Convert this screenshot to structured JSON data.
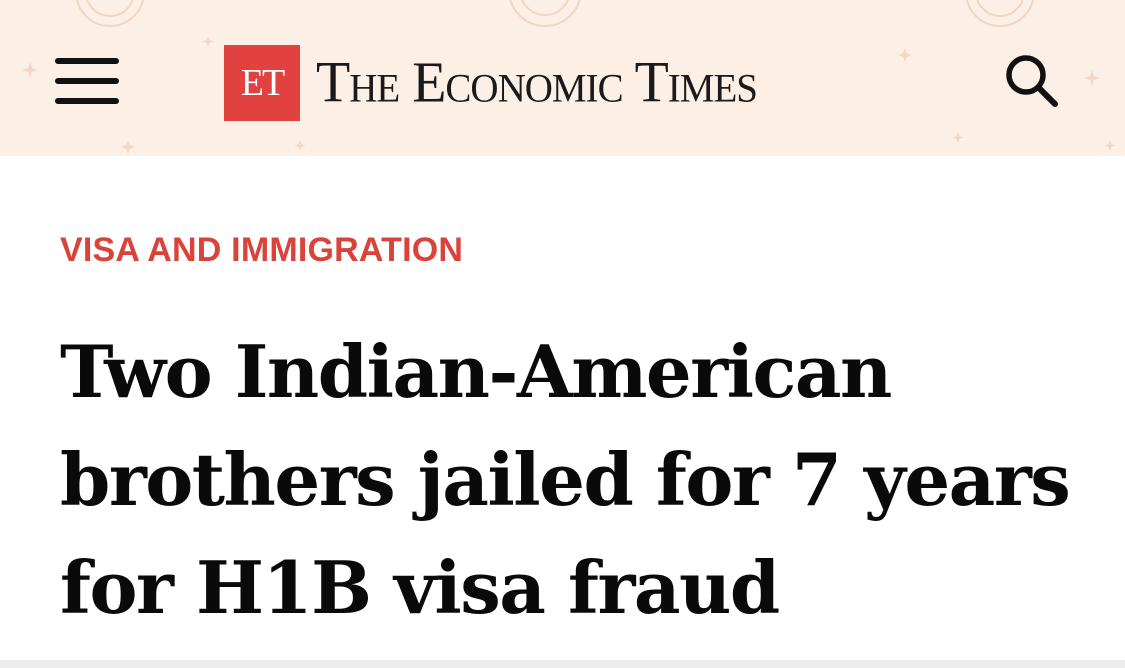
{
  "header": {
    "menu_icon": "hamburger-menu-icon",
    "logo": {
      "badge": "ET",
      "name": "The Economic Times"
    },
    "search_icon": "search-icon",
    "background_color": "#fbefe6",
    "accent_color": "#e1413f"
  },
  "article": {
    "category": "VISA AND IMMIGRATION",
    "category_color": "#d9433a",
    "headline_lines": [
      "Two Indian-American",
      "brothers jailed for 7 years",
      "for H1B visa fraud"
    ]
  }
}
